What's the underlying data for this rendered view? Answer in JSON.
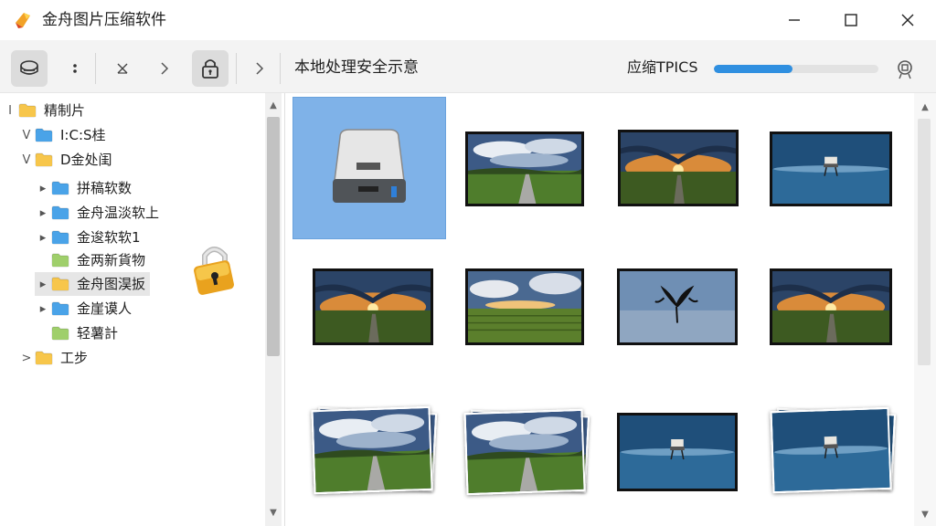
{
  "window": {
    "title": "金舟图片压缩软件",
    "controls": {
      "minimize": "minimize-icon",
      "maximize": "maximize-icon",
      "close": "close-icon"
    }
  },
  "toolbar": {
    "buttons": [
      "drive-icon",
      "more-vertical-icon",
      "close-icon",
      "chevron-right-icon",
      "lock-icon",
      "chevron-right-icon"
    ],
    "title": "本地处理安全示意",
    "progress_label": "应缩TPICS",
    "progress_value": 0.48,
    "right_icon": "pin-icon",
    "accent": "#2f8fe0"
  },
  "tree": {
    "items": [
      {
        "arrow": "I",
        "label": "精制片"
      },
      {
        "arrow": "V",
        "label": "I:C:S桂"
      },
      {
        "arrow": "V",
        "label": "D金处闺"
      },
      {
        "arrow": "▸",
        "label": "拼稿软数"
      },
      {
        "arrow": "▸",
        "label": "金舟温淡软上"
      },
      {
        "arrow": "▸",
        "label": "金逡软软1"
      },
      {
        "arrow": "",
        "label": "金两新貨物"
      },
      {
        "arrow": "▸",
        "label": "金舟图淏扳"
      },
      {
        "arrow": "▸",
        "label": "金崖谟人"
      },
      {
        "arrow": "",
        "label": "轻薯計"
      },
      {
        "arrow": ">",
        "label": "工步"
      }
    ],
    "overlay_icon": "padlock-icon"
  },
  "grid": {
    "items": [
      {
        "kind": "drive",
        "name": "removable-drive"
      },
      {
        "kind": "road",
        "name": "photo-road-sky"
      },
      {
        "kind": "sunset",
        "name": "photo-sunset-field"
      },
      {
        "kind": "lake",
        "name": "photo-lake-hut"
      },
      {
        "kind": "sunset",
        "name": "photo-sunset-field-2"
      },
      {
        "kind": "field",
        "name": "photo-field-clouds"
      },
      {
        "kind": "tree",
        "name": "photo-dark-tree-lake"
      },
      {
        "kind": "sunset",
        "name": "photo-sunset-field-3"
      },
      {
        "kind": "road",
        "name": "photo-road-sky-stack"
      },
      {
        "kind": "road",
        "name": "photo-road-sky-stack-2"
      },
      {
        "kind": "lake",
        "name": "photo-lake-hut-2"
      },
      {
        "kind": "lake",
        "name": "photo-lake-hut-stack"
      }
    ],
    "selection_color": "#7fb2e8"
  }
}
